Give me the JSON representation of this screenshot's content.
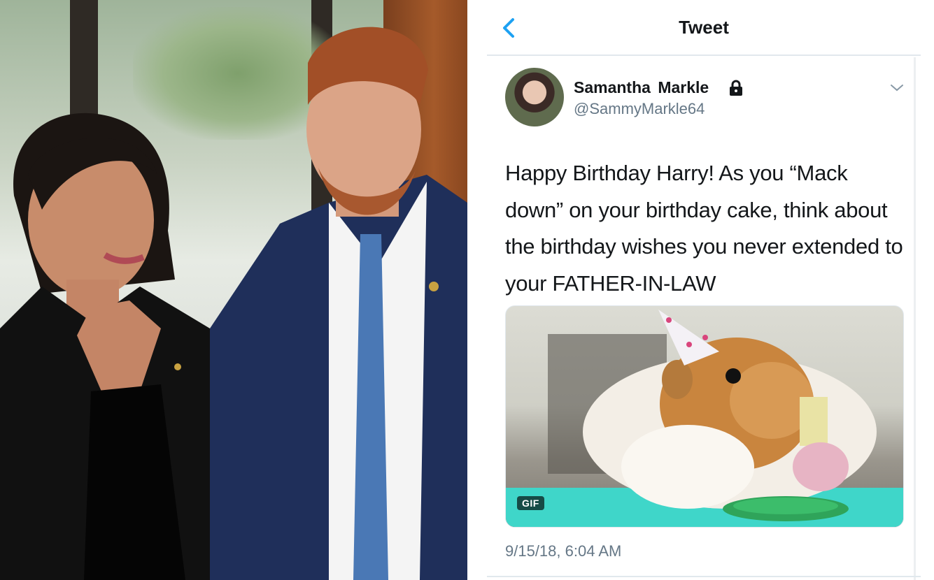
{
  "tweet_header": {
    "back_icon": "chevron-left-icon",
    "title": "Tweet"
  },
  "author": {
    "name": "Samantha Markle",
    "lock_icon": "lock-icon",
    "handle": "@SammyMarkle64",
    "menu_icon": "chevron-down-icon"
  },
  "tweet": {
    "text": "Happy Birthday Harry! As you “Mack down” on your birthday cake, think about the birthday wishes you never extended to your FATHER-IN-LAW",
    "media_badge": "GIF",
    "timestamp": "9/15/18, 6:04 AM"
  },
  "colors": {
    "accent": "#1da1f2",
    "text_primary": "#14171a",
    "text_secondary": "#657786",
    "divider": "#e1e8ed"
  }
}
